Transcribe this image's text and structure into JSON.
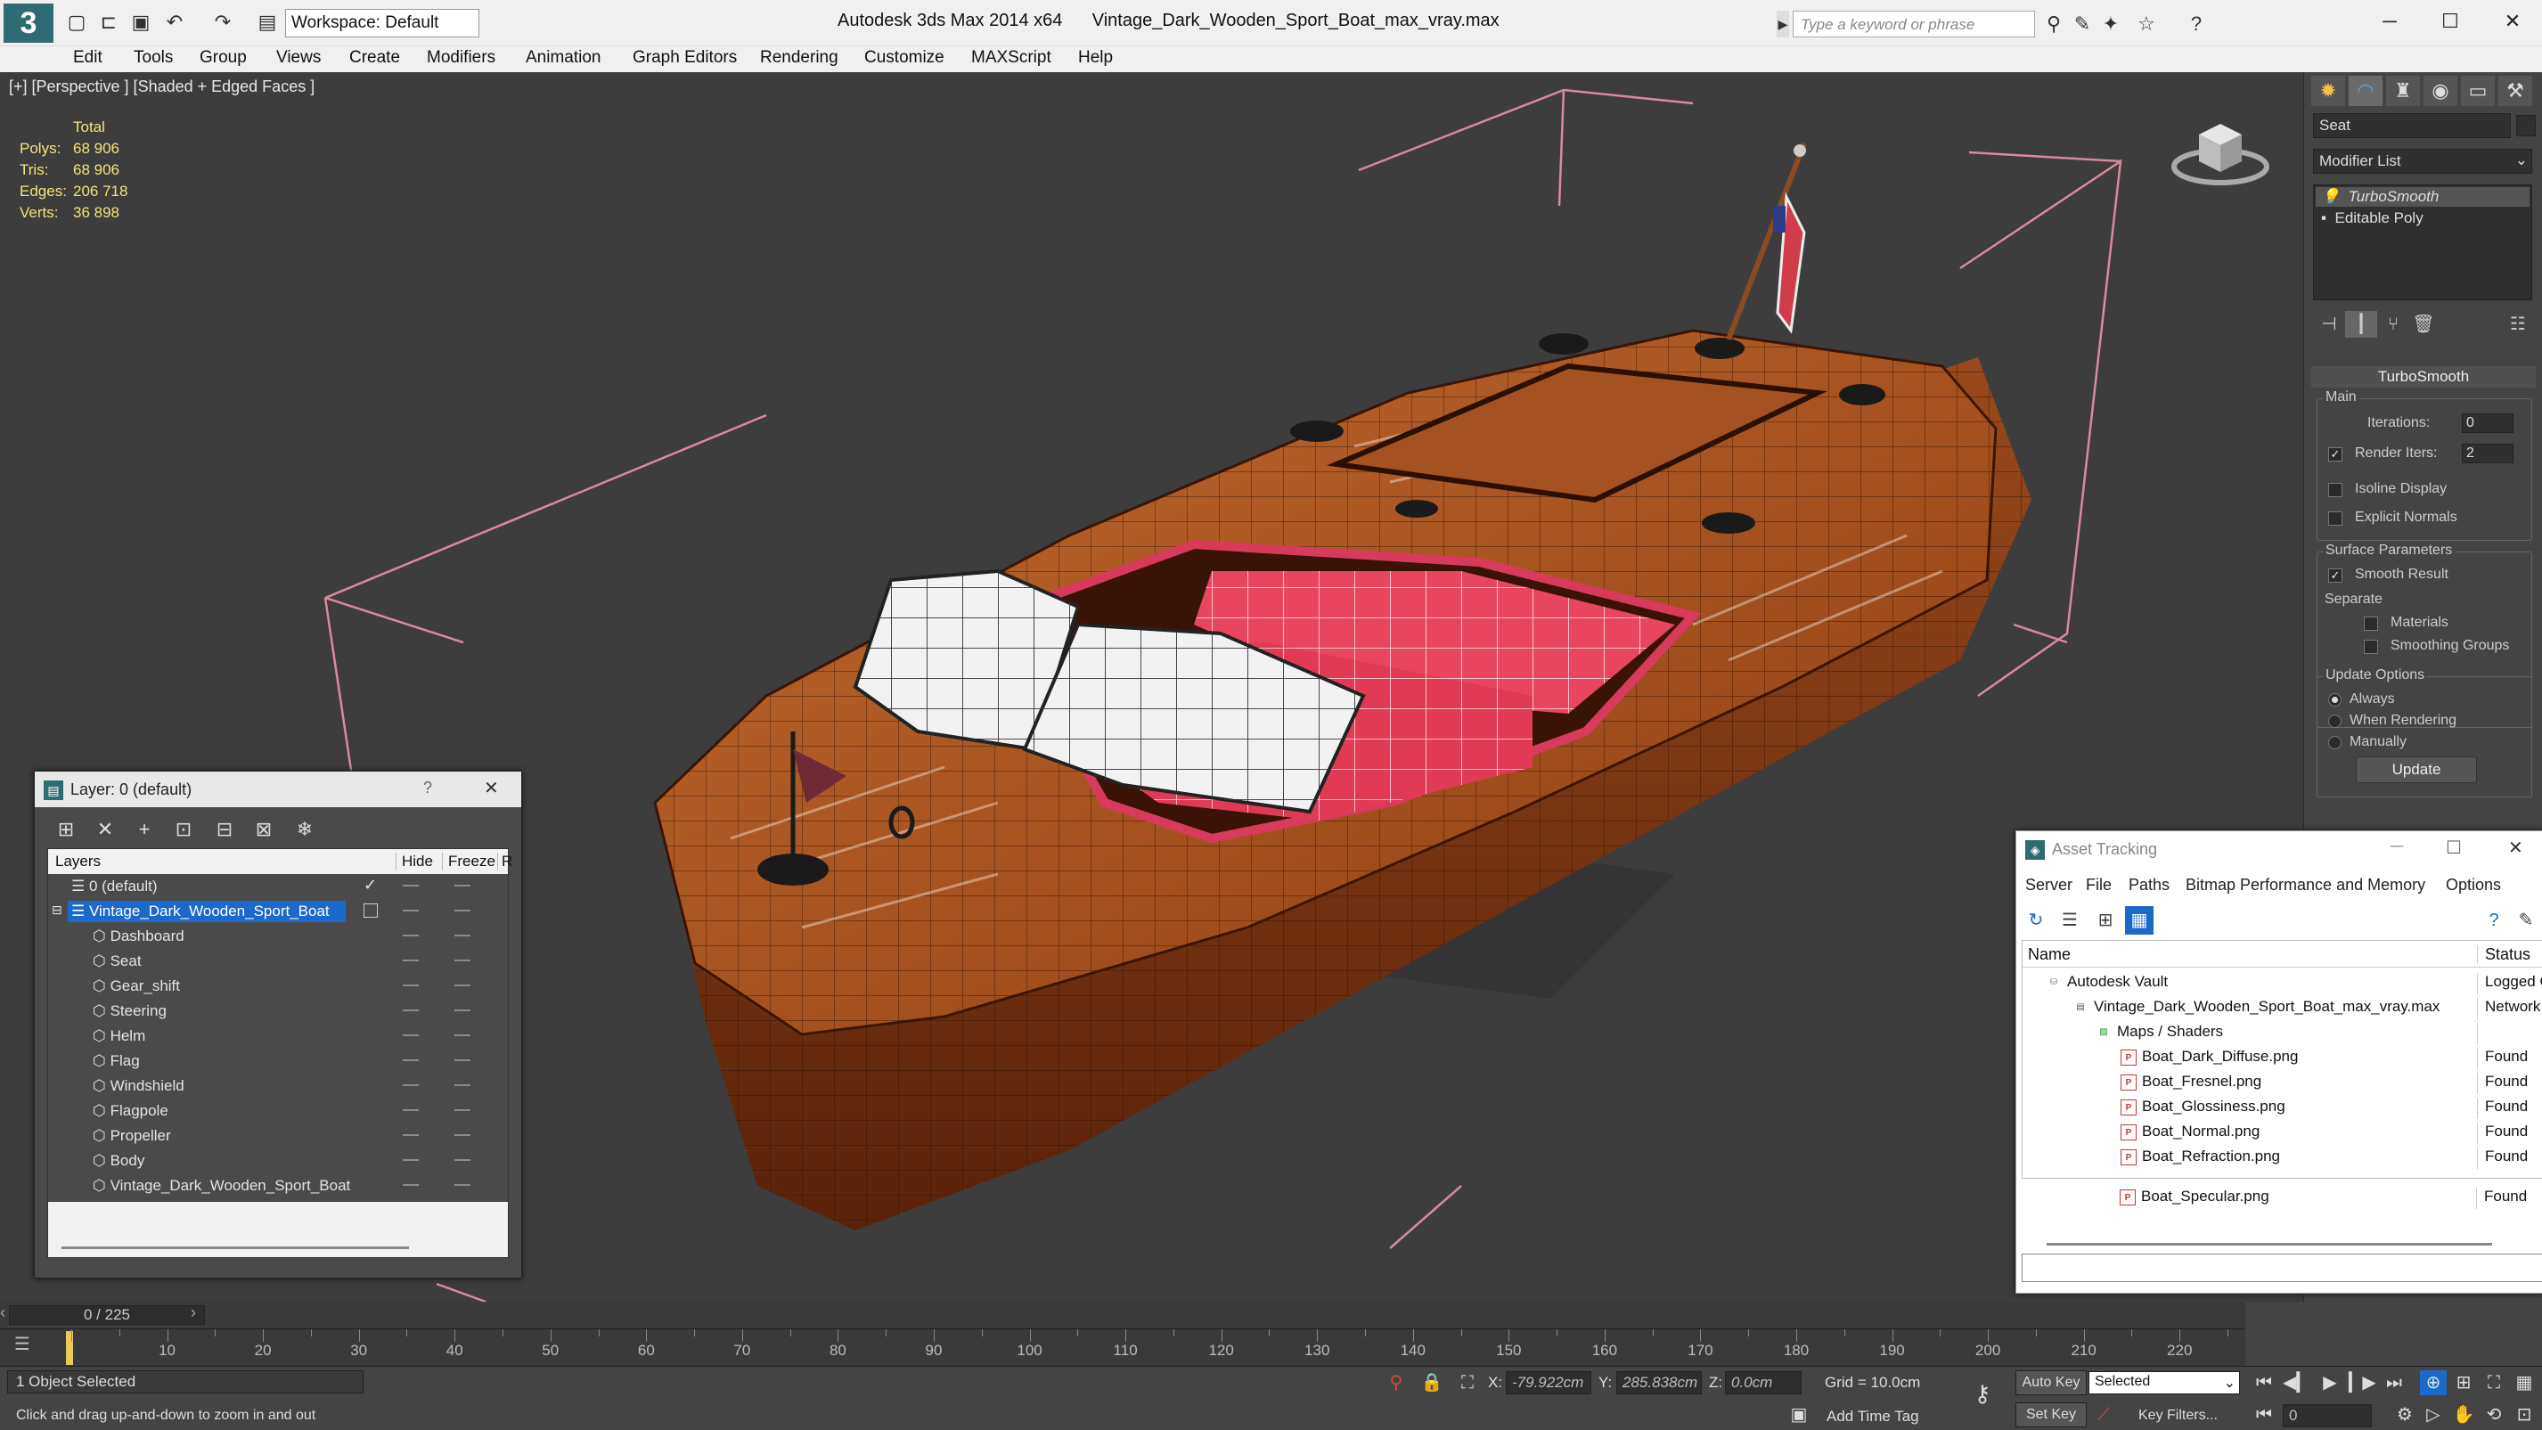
{
  "app": {
    "logo": "3",
    "title": "Autodesk 3ds Max  2014 x64",
    "filename": "Vintage_Dark_Wooden_Sport_Boat_max_vray.max",
    "workspace": "Workspace: Default",
    "search_placeholder": "Type a keyword or phrase"
  },
  "menu": [
    "Edit",
    "Tools",
    "Group",
    "Views",
    "Create",
    "Modifiers",
    "Animation",
    "Graph Editors",
    "Rendering",
    "Customize",
    "MAXScript",
    "Help"
  ],
  "viewport": {
    "label": "[+] [Perspective ] [Shaded + Edged Faces ]",
    "stats_header": "Total",
    "stats": [
      {
        "label": "Polys:",
        "value": "68 906"
      },
      {
        "label": "Tris:",
        "value": "68 906"
      },
      {
        "label": "Edges:",
        "value": "206 718"
      },
      {
        "label": "Verts:",
        "value": "36 898"
      }
    ]
  },
  "command_panel": {
    "object_name": "Seat",
    "modifier_list": "Modifier List",
    "stack": [
      "TurboSmooth",
      "Editable Poly"
    ],
    "rollout_title": "TurboSmooth",
    "main_group": "Main",
    "iterations_label": "Iterations:",
    "iterations_value": "0",
    "render_iters_label": "Render Iters:",
    "render_iters_value": "2",
    "isoline_display": "Isoline Display",
    "explicit_normals": "Explicit Normals",
    "surface_group": "Surface Parameters",
    "smooth_result": "Smooth Result",
    "separate": "Separate",
    "materials": "Materials",
    "smoothing_groups": "Smoothing Groups",
    "update_group": "Update Options",
    "always": "Always",
    "when_rendering": "When Rendering",
    "manually": "Manually",
    "update_button": "Update"
  },
  "layer_window": {
    "title": "Layer: 0 (default)",
    "help": "?",
    "close": "✕",
    "col_layers": "Layers",
    "col_hide": "Hide",
    "col_freeze": "Freeze",
    "col_r": "R",
    "rows": [
      {
        "name": "0 (default)",
        "level": 0
      },
      {
        "name": "Vintage_Dark_Wooden_Sport_Boat",
        "level": 0
      },
      {
        "name": "Dashboard",
        "level": 1
      },
      {
        "name": "Seat",
        "level": 1
      },
      {
        "name": "Gear_shift",
        "level": 1
      },
      {
        "name": "Steering",
        "level": 1
      },
      {
        "name": "Helm",
        "level": 1
      },
      {
        "name": "Flag",
        "level": 1
      },
      {
        "name": "Windshield",
        "level": 1
      },
      {
        "name": "Flagpole",
        "level": 1
      },
      {
        "name": "Propeller",
        "level": 1
      },
      {
        "name": "Body",
        "level": 1
      },
      {
        "name": "Vintage_Dark_Wooden_Sport_Boat",
        "level": 1
      }
    ]
  },
  "asset_window": {
    "title": "Asset Tracking",
    "menu": [
      "Server",
      "File",
      "Paths",
      "Bitmap Performance and Memory",
      "Options"
    ],
    "col_name": "Name",
    "col_status": "Status",
    "rows": [
      {
        "name": "Autodesk Vault",
        "status": "Logged Ou",
        "level": 1
      },
      {
        "name": "Vintage_Dark_Wooden_Sport_Boat_max_vray.max",
        "status": "Network Pa",
        "level": 2
      },
      {
        "name": "Maps / Shaders",
        "status": "",
        "level": 3
      },
      {
        "name": "Boat_Dark_Diffuse.png",
        "status": "Found",
        "level": 4
      },
      {
        "name": "Boat_Fresnel.png",
        "status": "Found",
        "level": 4
      },
      {
        "name": "Boat_Glossiness.png",
        "status": "Found",
        "level": 4
      },
      {
        "name": "Boat_Normal.png",
        "status": "Found",
        "level": 4
      },
      {
        "name": "Boat_Refraction.png",
        "status": "Found",
        "level": 4
      },
      {
        "name": "Boat_Specular.png",
        "status": "Found",
        "level": 4
      }
    ]
  },
  "timeline": {
    "frame": "0 / 225",
    "ticks": [
      "10",
      "20",
      "30",
      "40",
      "50",
      "60",
      "70",
      "80",
      "90",
      "100",
      "110",
      "120",
      "130",
      "140",
      "150",
      "160",
      "170",
      "180",
      "190",
      "200",
      "210",
      "220"
    ]
  },
  "status": {
    "selection": "1 Object Selected",
    "hint": "Click and drag up-and-down to zoom in and out",
    "x_label": "X:",
    "x_value": "-79.922cm",
    "y_label": "Y:",
    "y_value": "285.838cm",
    "z_label": "Z:",
    "z_value": "0.0cm",
    "grid": "Grid = 10.0cm",
    "add_time_tag": "Add Time Tag",
    "auto_key": "Auto Key",
    "set_key": "Set Key",
    "selected": "Selected",
    "key_filters": "Key Filters...",
    "frame_value": "0"
  }
}
